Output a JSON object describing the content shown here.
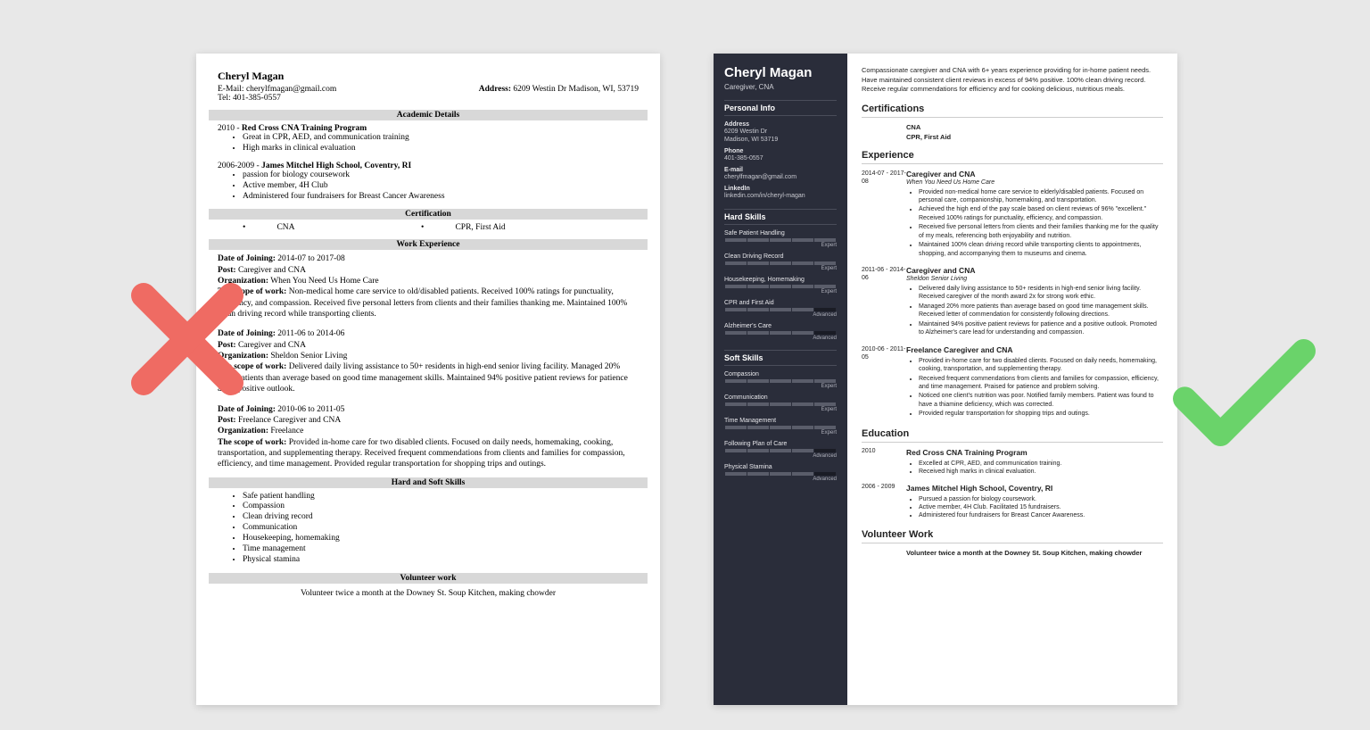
{
  "left": {
    "name": "Cheryl Magan",
    "email_label": "E-Mail:",
    "email": "cherylfmagan@gmail.com",
    "address_label": "Address:",
    "address": "6209 Westin Dr Madison, WI, 53719",
    "tel_label": "Tel:",
    "tel": "401-385-0557",
    "sections": {
      "academic": "Academic Details",
      "cert": "Certification",
      "work": "Work Experience",
      "skills": "Hard and Soft Skills",
      "volunteer": "Volunteer work"
    },
    "edu1_year": "2010 -",
    "edu1_title": "Red Cross CNA Training Program",
    "edu1_b1": "Great in CPR, AED, and communication training",
    "edu1_b2": "High marks in clinical evaluation",
    "edu2_year": "2006-2009 -",
    "edu2_title": "James Mitchel High School, Coventry, RI",
    "edu2_b1": "passion for biology coursework",
    "edu2_b2": "Active member, 4H Club",
    "edu2_b3": "Administered four fundraisers for Breast Cancer Awareness",
    "cert1": "CNA",
    "cert2": "CPR, First Aid",
    "doj_label": "Date of Joining:",
    "post_label": "Post:",
    "org_label": "Organization:",
    "scope_label": "The scope of work:",
    "job1_dates": "2014-07 to 2017-08",
    "job1_post": "Caregiver and CNA",
    "job1_org": "When You Need Us Home Care",
    "job1_scope": "Non-medical home care service to old/disabled patients. Received 100% ratings for punctuality, efficiency, and compassion. Received five personal letters from clients and their families thanking me. Maintained 100% clean driving record while transporting clients.",
    "job2_dates": "2011-06 to 2014-06",
    "job2_post": "Caregiver and CNA",
    "job2_org": "Sheldon Senior Living",
    "job2_scope": "Delivered daily living assistance to 50+ residents in high-end senior living facility. Managed 20% more patients than average based on good time management skills. Maintained 94% positive patient reviews for patience and a positive outlook.",
    "job3_dates": "2010-06 to 2011-05",
    "job3_post": "Freelance Caregiver and CNA",
    "job3_org": "Freelance",
    "job3_scope": "Provided in-home care for two disabled clients. Focused on daily needs, homemaking, cooking, transportation, and supplementing therapy. Received frequent commendations from clients and families for compassion, efficiency, and time management. Provided regular transportation for shopping trips and outings.",
    "sk1": "Safe patient handling",
    "sk2": "Compassion",
    "sk3": "Clean driving record",
    "sk4": "Communication",
    "sk5": "Housekeeping, homemaking",
    "sk6": "Time management",
    "sk7": "Physical stamina",
    "vol_text": "Volunteer twice a month at the Downey St. Soup Kitchen, making chowder"
  },
  "right": {
    "name": "Cheryl Magan",
    "title": "Caregiver, CNA",
    "sidebar_headers": {
      "personal": "Personal Info",
      "hard": "Hard Skills",
      "soft": "Soft Skills"
    },
    "info": {
      "address_lbl": "Address",
      "address1": "6209 Westin Dr",
      "address2": "Madison, WI 53719",
      "phone_lbl": "Phone",
      "phone": "401-385-0557",
      "email_lbl": "E-mail",
      "email": "cherylfmagan@gmail.com",
      "linkedin_lbl": "LinkedIn",
      "linkedin": "linkedin.com/in/cheryl-magan"
    },
    "hard_skills": [
      {
        "name": "Safe Patient Handling",
        "level": "Expert",
        "pct": 100
      },
      {
        "name": "Clean Driving Record",
        "level": "Expert",
        "pct": 100
      },
      {
        "name": "Housekeeping, Homemaking",
        "level": "Expert",
        "pct": 100
      },
      {
        "name": "CPR and First Aid",
        "level": "Advanced",
        "pct": 80
      },
      {
        "name": "Alzheimer's Care",
        "level": "Advanced",
        "pct": 80
      }
    ],
    "soft_skills": [
      {
        "name": "Compassion",
        "level": "Expert",
        "pct": 100
      },
      {
        "name": "Communication",
        "level": "Expert",
        "pct": 100
      },
      {
        "name": "Time Management",
        "level": "Expert",
        "pct": 100
      },
      {
        "name": "Following Plan of Care",
        "level": "Advanced",
        "pct": 80
      },
      {
        "name": "Physical Stamina",
        "level": "Advanced",
        "pct": 80
      }
    ],
    "summary": "Compassionate caregiver and CNA with 6+ years experience providing for in-home patient needs. Have maintained consistent client reviews in excess of 94% positive. 100% clean driving record. Receive regular commendations for efficiency and for cooking delicious, nutritious meals.",
    "headers": {
      "cert": "Certifications",
      "exp": "Experience",
      "edu": "Education",
      "vol": "Volunteer Work"
    },
    "certs": {
      "c1": "CNA",
      "c2": "CPR, First Aid"
    },
    "exp": [
      {
        "dates": "2014-07 - 2017-08",
        "role": "Caregiver and CNA",
        "org": "When You Need Us Home Care",
        "bullets": [
          "Provided non-medical home care service to elderly/disabled patients. Focused on personal care, companionship, homemaking, and transportation.",
          "Achieved the high end of the pay scale based on client reviews of 96% \"excellent.\" Received 100% ratings for punctuality, efficiency, and compassion.",
          "Received five personal letters from clients and their families thanking me for the quality of my meals, referencing both enjoyability and nutrition.",
          "Maintained 100% clean driving record while transporting clients to appointments, shopping, and accompanying them to museums and cinema."
        ]
      },
      {
        "dates": "2011-06 - 2014-06",
        "role": "Caregiver and CNA",
        "org": "Sheldon Senior Living",
        "bullets": [
          "Delivered daily living assistance to 50+ residents in high-end senior living facility. Received caregiver of the month award 2x for strong work ethic.",
          "Managed 20% more patients than average based on good time management skills. Received letter of commendation for consistently following directions.",
          "Maintained 94% positive patient reviews for patience and a positive outlook. Promoted to Alzheimer's care lead for understanding and compassion."
        ]
      },
      {
        "dates": "2010-06 - 2011-05",
        "role": "Freelance Caregiver and CNA",
        "org": "",
        "bullets": [
          "Provided in-home care for two disabled clients. Focused on daily needs, homemaking, cooking, transportation, and supplementing therapy.",
          "Received frequent commendations from clients and families for compassion, efficiency, and time management. Praised for patience and problem solving.",
          "Noticed one client's nutrition was poor. Notified family members. Patient was found to have a thiamine deficiency, which was corrected.",
          "Provided regular transportation for shopping trips and outings."
        ]
      }
    ],
    "edu": [
      {
        "dates": "2010",
        "school": "Red Cross CNA Training Program",
        "bullets": [
          "Excelled at CPR, AED, and communication training.",
          "Received high marks in clinical evaluation."
        ]
      },
      {
        "dates": "2006 - 2009",
        "school": "James Mitchel High School, Coventry, RI",
        "bullets": [
          "Pursued a passion for biology coursework.",
          "Active member, 4H Club. Facilitated 15 fundraisers.",
          "Administered four fundraisers for Breast Cancer Awareness."
        ]
      }
    ],
    "vol": "Volunteer twice a month at the Downey St. Soup Kitchen, making chowder"
  }
}
